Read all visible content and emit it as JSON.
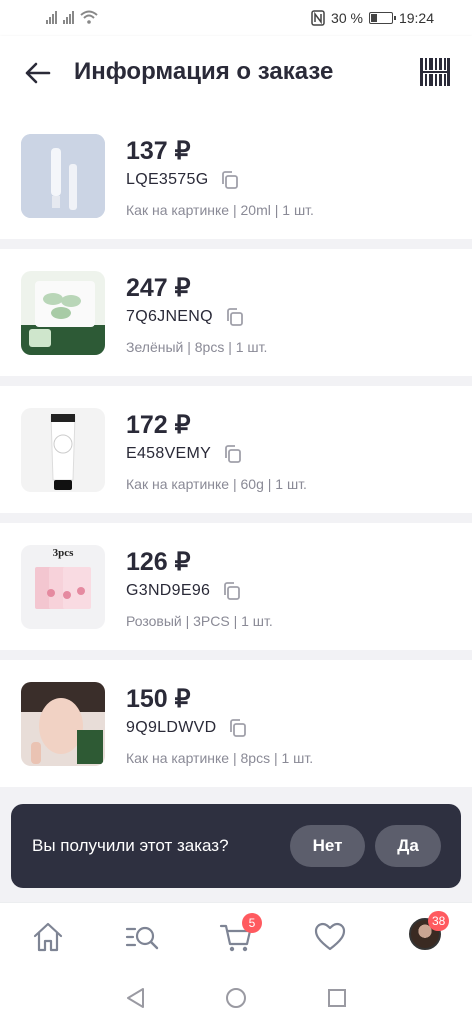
{
  "status_bar": {
    "battery": "30 %",
    "time": "19:24",
    "battery_level": 0.3
  },
  "header": {
    "title": "Информация о заказе",
    "back_icon": "arrow-left-icon",
    "scan_icon": "barcode-icon"
  },
  "items": [
    {
      "price": "137 ₽",
      "sku": "LQE3575G",
      "meta": "Как на картинке | 20ml | 1 шт.",
      "thumb_label": ""
    },
    {
      "price": "247 ₽",
      "sku": "7Q6JNENQ",
      "meta": "Зелёный | 8pcs | 1 шт.",
      "thumb_label": ""
    },
    {
      "price": "172 ₽",
      "sku": "E458VEMY",
      "meta": "Как на картинке | 60g | 1 шт.",
      "thumb_label": ""
    },
    {
      "price": "126 ₽",
      "sku": "G3ND9E96",
      "meta": "Розовый | 3PCS | 1 шт.",
      "thumb_label": "3pcs"
    },
    {
      "price": "150 ₽",
      "sku": "9Q9LDWVD",
      "meta": "Как на картинке | 8pcs | 1 шт.",
      "thumb_label": ""
    }
  ],
  "prompt": {
    "question": "Вы получили этот заказ?",
    "no_label": "Нет",
    "yes_label": "Да"
  },
  "bottom_nav": {
    "items": [
      "home-icon",
      "catalog-search-icon",
      "cart-icon",
      "heart-icon",
      "profile-avatar"
    ],
    "cart_badge": "5",
    "profile_badge": "38"
  },
  "colors": {
    "accent_dark": "#2e3040",
    "badge": "#ff5a5f",
    "text": "#2a2a38",
    "muted": "#8a8a96"
  }
}
